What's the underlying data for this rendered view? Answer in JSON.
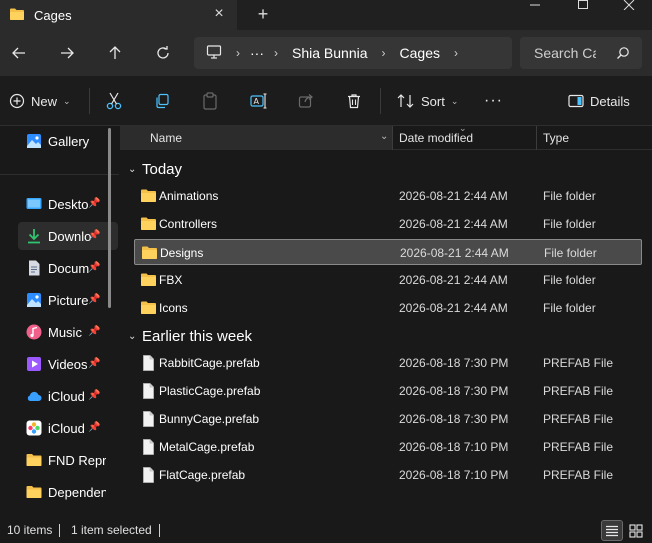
{
  "window": {
    "tab_title": "Cages",
    "new_tab_label": "+",
    "close_tab_label": "×"
  },
  "navigation": {
    "breadcrumb": [
      "Shia Bunnia",
      "Cages"
    ],
    "more_label": "···",
    "search_placeholder": "Search Ca"
  },
  "toolbar": {
    "new_label": "New",
    "sort_label": "Sort",
    "more_label": "···",
    "details_label": "Details"
  },
  "sidebar": {
    "items": [
      {
        "label": "Gallery",
        "icon": "gallery-icon",
        "pinned": false
      },
      {
        "label": "Deskto",
        "icon": "desktop-icon",
        "pinned": true
      },
      {
        "label": "Downlo",
        "icon": "download-icon",
        "pinned": true
      },
      {
        "label": "Docum",
        "icon": "document-icon",
        "pinned": true
      },
      {
        "label": "Picture",
        "icon": "pictures-icon",
        "pinned": true
      },
      {
        "label": "Music",
        "icon": "music-icon",
        "pinned": true
      },
      {
        "label": "Videos",
        "icon": "videos-icon",
        "pinned": true
      },
      {
        "label": "iCloud",
        "icon": "icloud-drive-icon",
        "pinned": true
      },
      {
        "label": "iCloud",
        "icon": "icloud-photos-icon",
        "pinned": true
      },
      {
        "label": "FND Repri",
        "icon": "folder-icon",
        "pinned": false
      },
      {
        "label": "Dependen",
        "icon": "folder-icon",
        "pinned": false
      }
    ],
    "pin_glyph": "📌"
  },
  "columns": {
    "name": "Name",
    "date": "Date modified",
    "type": "Type"
  },
  "groups": [
    {
      "label": "Today",
      "items": [
        {
          "name": "Animations",
          "date": "2026-08-21 2:44 AM",
          "type": "File folder",
          "kind": "folder"
        },
        {
          "name": "Controllers",
          "date": "2026-08-21 2:44 AM",
          "type": "File folder",
          "kind": "folder"
        },
        {
          "name": "Designs",
          "date": "2026-08-21 2:44 AM",
          "type": "File folder",
          "kind": "folder",
          "selected": true
        },
        {
          "name": "FBX",
          "date": "2026-08-21 2:44 AM",
          "type": "File folder",
          "kind": "folder"
        },
        {
          "name": "Icons",
          "date": "2026-08-21 2:44 AM",
          "type": "File folder",
          "kind": "folder"
        }
      ]
    },
    {
      "label": "Earlier this week",
      "items": [
        {
          "name": "RabbitCage.prefab",
          "date": "2026-08-18 7:30 PM",
          "type": "PREFAB File",
          "kind": "file"
        },
        {
          "name": "PlasticCage.prefab",
          "date": "2026-08-18 7:30 PM",
          "type": "PREFAB File",
          "kind": "file"
        },
        {
          "name": "BunnyCage.prefab",
          "date": "2026-08-18 7:30 PM",
          "type": "PREFAB File",
          "kind": "file"
        },
        {
          "name": "MetalCage.prefab",
          "date": "2026-08-18 7:10 PM",
          "type": "PREFAB File",
          "kind": "file"
        },
        {
          "name": "FlatCage.prefab",
          "date": "2026-08-18 7:10 PM",
          "type": "PREFAB File",
          "kind": "file"
        }
      ]
    }
  ],
  "status": {
    "item_count": "10 items",
    "selection": "1 item selected"
  },
  "colors": {
    "folder": "#f4c04a",
    "accent": "#4cc2ff",
    "background": "#191919"
  }
}
